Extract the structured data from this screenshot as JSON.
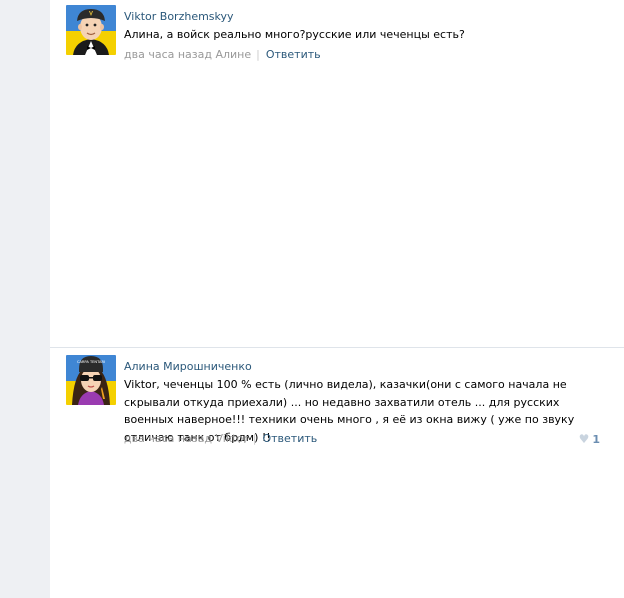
{
  "comments": [
    {
      "author": "Viktor Borzhemskyy",
      "text": "Алина, а войск реально много?русские или чеченцы есть?",
      "time": "два часа назад Алине",
      "separator": "|",
      "reply_label": "Ответить"
    },
    {
      "author": "Алина Мирошниченко",
      "text": "Viktor, чеченцы 100 % есть (лично видела), казачки(они с самого начала не скрывали откуда приехали) ... но недавно захватили отель ... для русских военных наверное!!! техники очень много , я её из окна вижу ( уже по звуку отличаю танк от брдм) !!",
      "time": "два часа назад Viktor",
      "separator": "|",
      "reply_label": "Ответить",
      "likes": "1",
      "avatar_badge": "CARPA TENTARI"
    }
  ],
  "icons": {
    "like": "heart-icon"
  },
  "colors": {
    "link": "#2b587a",
    "meta": "#999999",
    "gutter": "#eef0f3",
    "like": "#6a8db1"
  }
}
